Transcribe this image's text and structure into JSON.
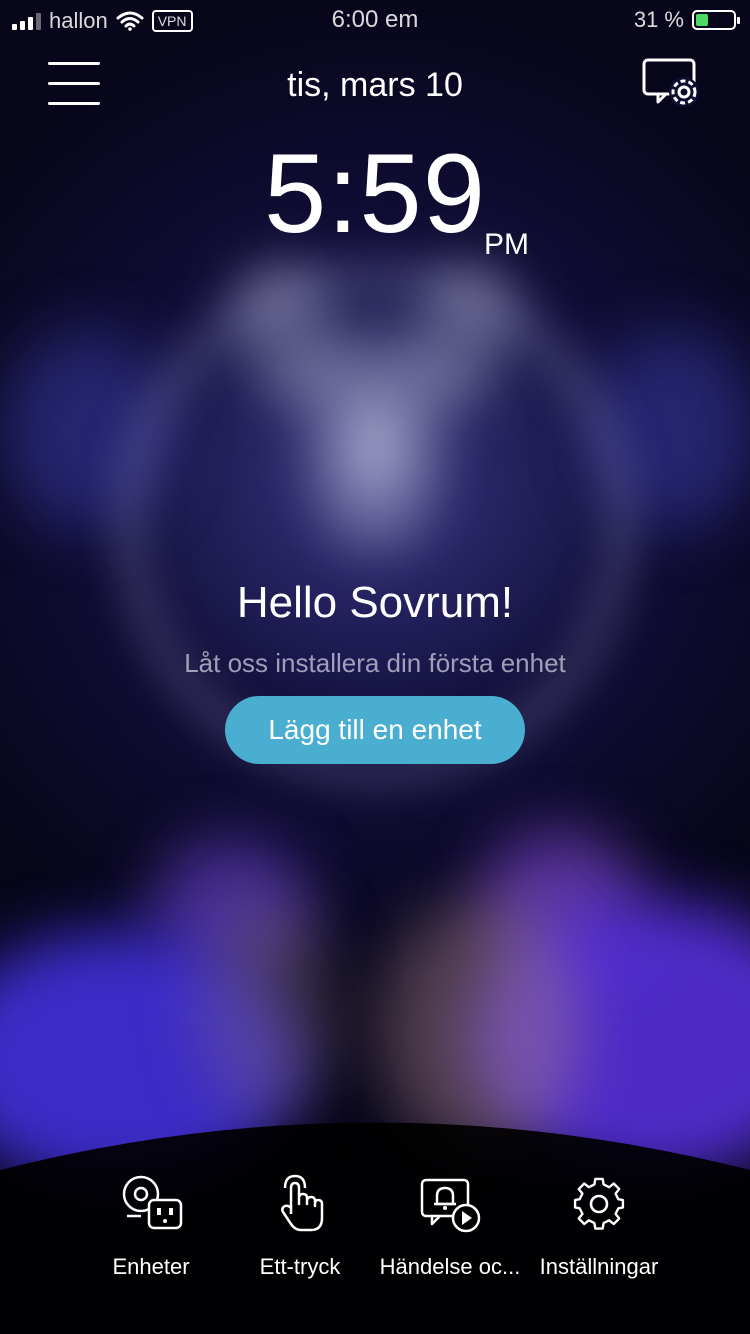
{
  "status_bar": {
    "carrier": "hallon",
    "vpn": "VPN",
    "time": "6:00 em",
    "battery": "31 %"
  },
  "header": {
    "date": "tis, mars 10",
    "menu_icon": "hamburger-menu-icon",
    "settings_icon": "screen-settings-icon"
  },
  "clock": {
    "time": "5:59",
    "ampm": "PM"
  },
  "greeting": {
    "title": "Hello Sovrum!",
    "subtitle": "Låt oss installera din första enhet",
    "add_button": "Lägg till en enhet"
  },
  "bottom_nav": {
    "items": [
      {
        "label": "Enheter",
        "icon": "devices-icon"
      },
      {
        "label": "Ett-tryck",
        "icon": "tap-hand-icon"
      },
      {
        "label": "Händelse oc...",
        "icon": "event-bell-icon"
      },
      {
        "label": "Inställningar",
        "icon": "gear-icon"
      }
    ]
  },
  "colors": {
    "accent": "#4aaed0",
    "battery_fill": "#4cd964",
    "background": "#0a0820"
  }
}
